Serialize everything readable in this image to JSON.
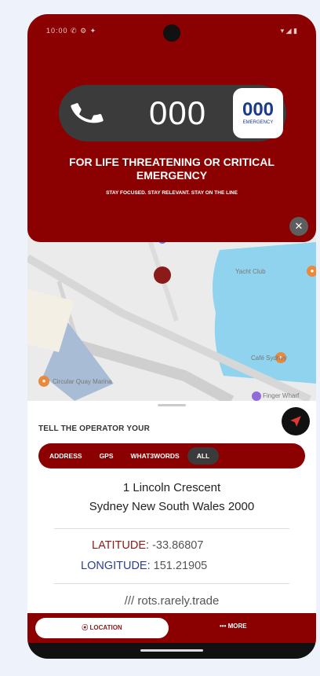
{
  "status": {
    "left": "10:00 ✆ ⚙ ✦",
    "right": "▾ ◢ ▮"
  },
  "emergency": {
    "number": "000",
    "logo_number": "000",
    "logo_text": "EMERGENCY",
    "headline": "FOR LIFE THREATENING OR CRITICAL EMERGENCY",
    "subline": "STAY FOCUSED. STAY RELEVANT. STAY ON THE LINE",
    "close_label": "✕"
  },
  "map": {
    "labels": [
      "Yacht Club",
      "Café Sydney",
      "Circular Quay Marina",
      "Finger Wharf"
    ]
  },
  "sheet": {
    "tell_label": "TELL THE OPERATOR YOUR",
    "tabs": [
      "ADDRESS",
      "GPS",
      "WHAT3WORDS",
      "ALL"
    ],
    "address_line1": "1 Lincoln Crescent",
    "address_line2": "Sydney New South Wales 2000",
    "latitude_label": "LATITUDE:",
    "latitude_value": "-33.86807",
    "longitude_label": "LONGITUDE:",
    "longitude_value": "151.21905",
    "w3w": "/// rots.rarely.trade"
  },
  "bottom_bar": {
    "location_label": "LOCATION",
    "more_label": "••• MORE"
  },
  "colors": {
    "primary": "#8b0000",
    "pill": "#3b3b3b",
    "lat_label": "#8b1a1a",
    "lon_label": "#2d3f8c"
  }
}
